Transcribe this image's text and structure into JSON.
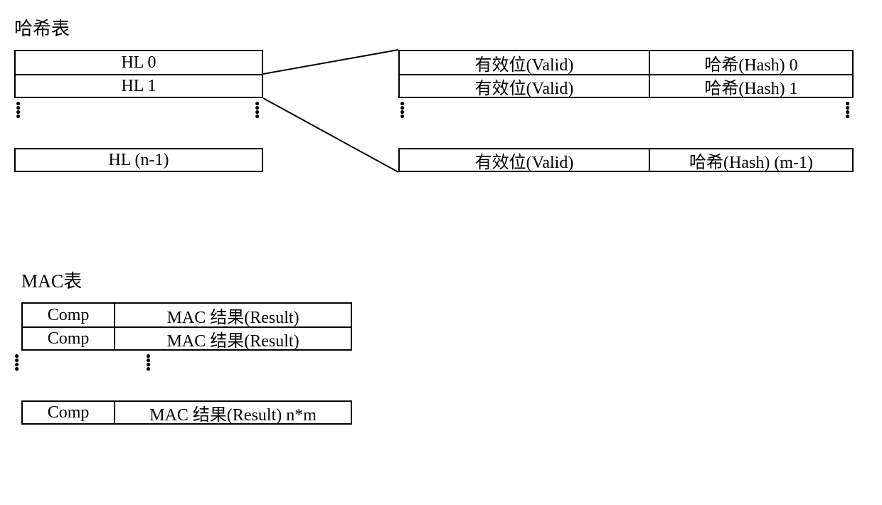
{
  "hashTable": {
    "title": "哈希表",
    "leftRows": {
      "r0": "HL 0",
      "r1": "HL 1",
      "rLast": "HL (n-1)"
    },
    "rightRows": {
      "r0": {
        "valid": "有效位(Valid)",
        "hash": "哈希(Hash) 0"
      },
      "r1": {
        "valid": "有效位(Valid)",
        "hash": "哈希(Hash) 1"
      },
      "rLast": {
        "valid": "有效位(Valid)",
        "hash": "哈希(Hash) (m-1)"
      }
    }
  },
  "macTable": {
    "title": "MAC表",
    "rows": {
      "r0": {
        "comp": "Comp",
        "result": "MAC 结果(Result)"
      },
      "r1": {
        "comp": "Comp",
        "result": "MAC 结果(Result)"
      },
      "rLast": {
        "comp": "Comp",
        "result": "MAC 结果(Result) n*m"
      }
    }
  }
}
